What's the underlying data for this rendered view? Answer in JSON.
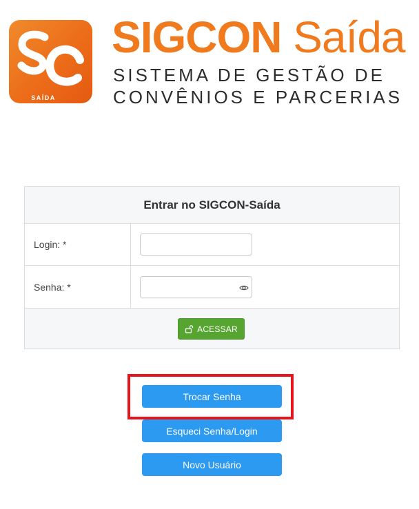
{
  "header": {
    "logo_mark": "SC",
    "logo_subtext": "SAÍDA",
    "title_bold": "SIGCON",
    "title_light": "Saída",
    "subtitle_line1": "SISTEMA DE GESTÃO DE",
    "subtitle_line2": "CONVÊNIOS E PARCERIAS",
    "brand_color": "#f07a1e"
  },
  "login_panel": {
    "title": "Entrar no SIGCON-Saída",
    "login_label": "Login: *",
    "login_value": "",
    "senha_label": "Senha: *",
    "senha_value": "",
    "show_password_icon": "eye-icon",
    "submit_icon": "unlock-icon",
    "submit_label": "ACESSAR",
    "submit_color": "#55a530"
  },
  "actions": {
    "change_password_label": "Trocar Senha",
    "forgot_label": "Esqueci Senha/Login",
    "new_user_label": "Novo Usuário",
    "button_color": "#2c9af0",
    "highlight_color": "#e8141c"
  }
}
